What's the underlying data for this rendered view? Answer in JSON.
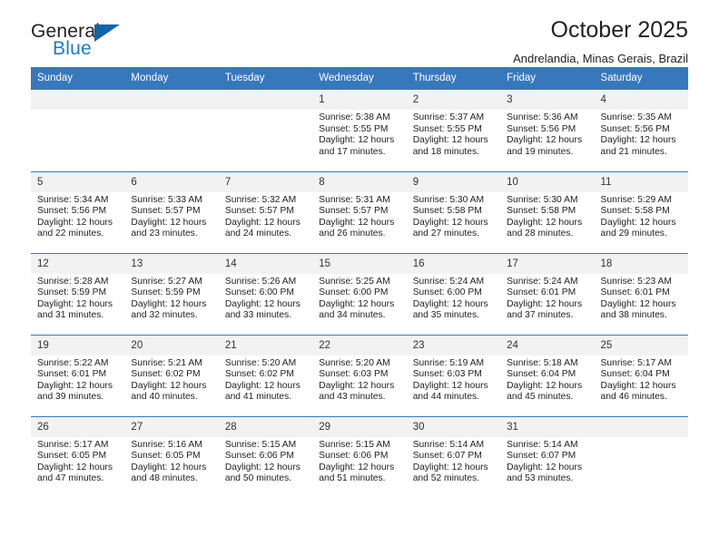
{
  "brand": {
    "word1": "General",
    "word2": "Blue",
    "triangle_color": "#1364a5",
    "blue_color": "#1f7bc1"
  },
  "header": {
    "title": "October 2025",
    "location": "Andrelandia, Minas Gerais, Brazil"
  },
  "calendar": {
    "header_bg": "#3778bc",
    "daynum_bg": "#f2f2f2",
    "weekday_headers": [
      "Sunday",
      "Monday",
      "Tuesday",
      "Wednesday",
      "Thursday",
      "Friday",
      "Saturday"
    ],
    "labels": {
      "sunrise": "Sunrise:",
      "sunset": "Sunset:",
      "daylight": "Daylight:"
    },
    "weeks": [
      [
        {
          "day": "",
          "empty": true
        },
        {
          "day": "",
          "empty": true
        },
        {
          "day": "",
          "empty": true
        },
        {
          "day": "1",
          "sunrise": "Sunrise: 5:38 AM",
          "sunset": "Sunset: 5:55 PM",
          "daylight": "Daylight: 12 hours and 17 minutes."
        },
        {
          "day": "2",
          "sunrise": "Sunrise: 5:37 AM",
          "sunset": "Sunset: 5:55 PM",
          "daylight": "Daylight: 12 hours and 18 minutes."
        },
        {
          "day": "3",
          "sunrise": "Sunrise: 5:36 AM",
          "sunset": "Sunset: 5:56 PM",
          "daylight": "Daylight: 12 hours and 19 minutes."
        },
        {
          "day": "4",
          "sunrise": "Sunrise: 5:35 AM",
          "sunset": "Sunset: 5:56 PM",
          "daylight": "Daylight: 12 hours and 21 minutes."
        }
      ],
      [
        {
          "day": "5",
          "sunrise": "Sunrise: 5:34 AM",
          "sunset": "Sunset: 5:56 PM",
          "daylight": "Daylight: 12 hours and 22 minutes."
        },
        {
          "day": "6",
          "sunrise": "Sunrise: 5:33 AM",
          "sunset": "Sunset: 5:57 PM",
          "daylight": "Daylight: 12 hours and 23 minutes."
        },
        {
          "day": "7",
          "sunrise": "Sunrise: 5:32 AM",
          "sunset": "Sunset: 5:57 PM",
          "daylight": "Daylight: 12 hours and 24 minutes."
        },
        {
          "day": "8",
          "sunrise": "Sunrise: 5:31 AM",
          "sunset": "Sunset: 5:57 PM",
          "daylight": "Daylight: 12 hours and 26 minutes."
        },
        {
          "day": "9",
          "sunrise": "Sunrise: 5:30 AM",
          "sunset": "Sunset: 5:58 PM",
          "daylight": "Daylight: 12 hours and 27 minutes."
        },
        {
          "day": "10",
          "sunrise": "Sunrise: 5:30 AM",
          "sunset": "Sunset: 5:58 PM",
          "daylight": "Daylight: 12 hours and 28 minutes."
        },
        {
          "day": "11",
          "sunrise": "Sunrise: 5:29 AM",
          "sunset": "Sunset: 5:58 PM",
          "daylight": "Daylight: 12 hours and 29 minutes."
        }
      ],
      [
        {
          "day": "12",
          "sunrise": "Sunrise: 5:28 AM",
          "sunset": "Sunset: 5:59 PM",
          "daylight": "Daylight: 12 hours and 31 minutes."
        },
        {
          "day": "13",
          "sunrise": "Sunrise: 5:27 AM",
          "sunset": "Sunset: 5:59 PM",
          "daylight": "Daylight: 12 hours and 32 minutes."
        },
        {
          "day": "14",
          "sunrise": "Sunrise: 5:26 AM",
          "sunset": "Sunset: 6:00 PM",
          "daylight": "Daylight: 12 hours and 33 minutes."
        },
        {
          "day": "15",
          "sunrise": "Sunrise: 5:25 AM",
          "sunset": "Sunset: 6:00 PM",
          "daylight": "Daylight: 12 hours and 34 minutes."
        },
        {
          "day": "16",
          "sunrise": "Sunrise: 5:24 AM",
          "sunset": "Sunset: 6:00 PM",
          "daylight": "Daylight: 12 hours and 35 minutes."
        },
        {
          "day": "17",
          "sunrise": "Sunrise: 5:24 AM",
          "sunset": "Sunset: 6:01 PM",
          "daylight": "Daylight: 12 hours and 37 minutes."
        },
        {
          "day": "18",
          "sunrise": "Sunrise: 5:23 AM",
          "sunset": "Sunset: 6:01 PM",
          "daylight": "Daylight: 12 hours and 38 minutes."
        }
      ],
      [
        {
          "day": "19",
          "sunrise": "Sunrise: 5:22 AM",
          "sunset": "Sunset: 6:01 PM",
          "daylight": "Daylight: 12 hours and 39 minutes."
        },
        {
          "day": "20",
          "sunrise": "Sunrise: 5:21 AM",
          "sunset": "Sunset: 6:02 PM",
          "daylight": "Daylight: 12 hours and 40 minutes."
        },
        {
          "day": "21",
          "sunrise": "Sunrise: 5:20 AM",
          "sunset": "Sunset: 6:02 PM",
          "daylight": "Daylight: 12 hours and 41 minutes."
        },
        {
          "day": "22",
          "sunrise": "Sunrise: 5:20 AM",
          "sunset": "Sunset: 6:03 PM",
          "daylight": "Daylight: 12 hours and 43 minutes."
        },
        {
          "day": "23",
          "sunrise": "Sunrise: 5:19 AM",
          "sunset": "Sunset: 6:03 PM",
          "daylight": "Daylight: 12 hours and 44 minutes."
        },
        {
          "day": "24",
          "sunrise": "Sunrise: 5:18 AM",
          "sunset": "Sunset: 6:04 PM",
          "daylight": "Daylight: 12 hours and 45 minutes."
        },
        {
          "day": "25",
          "sunrise": "Sunrise: 5:17 AM",
          "sunset": "Sunset: 6:04 PM",
          "daylight": "Daylight: 12 hours and 46 minutes."
        }
      ],
      [
        {
          "day": "26",
          "sunrise": "Sunrise: 5:17 AM",
          "sunset": "Sunset: 6:05 PM",
          "daylight": "Daylight: 12 hours and 47 minutes."
        },
        {
          "day": "27",
          "sunrise": "Sunrise: 5:16 AM",
          "sunset": "Sunset: 6:05 PM",
          "daylight": "Daylight: 12 hours and 48 minutes."
        },
        {
          "day": "28",
          "sunrise": "Sunrise: 5:15 AM",
          "sunset": "Sunset: 6:06 PM",
          "daylight": "Daylight: 12 hours and 50 minutes."
        },
        {
          "day": "29",
          "sunrise": "Sunrise: 5:15 AM",
          "sunset": "Sunset: 6:06 PM",
          "daylight": "Daylight: 12 hours and 51 minutes."
        },
        {
          "day": "30",
          "sunrise": "Sunrise: 5:14 AM",
          "sunset": "Sunset: 6:07 PM",
          "daylight": "Daylight: 12 hours and 52 minutes."
        },
        {
          "day": "31",
          "sunrise": "Sunrise: 5:14 AM",
          "sunset": "Sunset: 6:07 PM",
          "daylight": "Daylight: 12 hours and 53 minutes."
        },
        {
          "day": "",
          "empty": true
        }
      ]
    ]
  }
}
